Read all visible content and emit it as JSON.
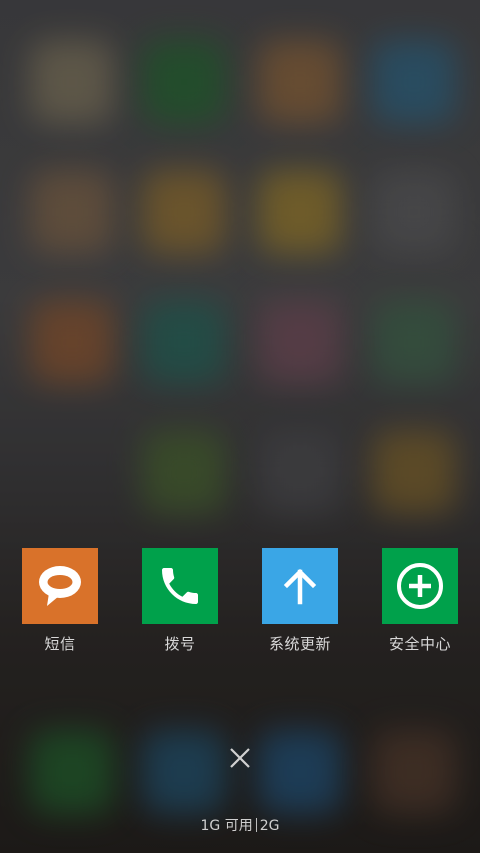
{
  "recent_apps": [
    {
      "label": "短信",
      "icon": "message-bubble-icon",
      "color": "#D9722A"
    },
    {
      "label": "拨号",
      "icon": "phone-icon",
      "color": "#00A14B"
    },
    {
      "label": "系统更新",
      "icon": "arrow-up-icon",
      "color": "#3AA6E6"
    },
    {
      "label": "安全中心",
      "icon": "plus-circle-icon",
      "color": "#00A14B"
    }
  ],
  "close_icon": "close-icon",
  "memory": {
    "available": "1G 可用",
    "total": "2G"
  }
}
